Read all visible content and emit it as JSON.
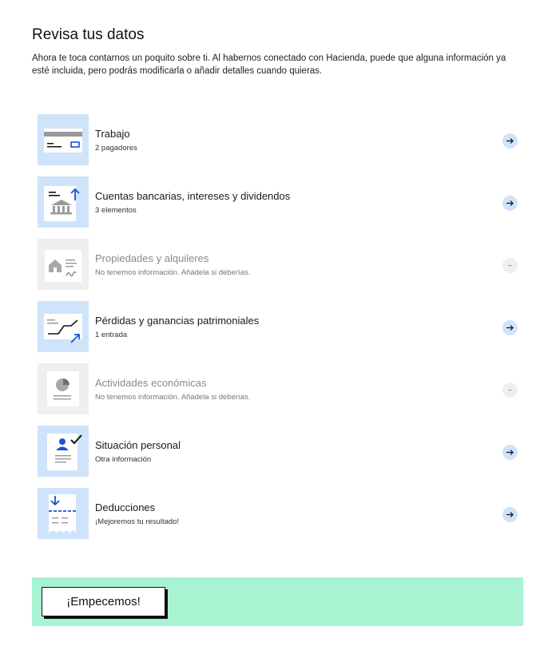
{
  "header": {
    "title": "Revisa tus datos",
    "intro": "Ahora te toca contarnos un poquito sobre ti. Al habernos conectado con Hacienda, puede que alguna información ya esté incluida, pero podrás modificarla o añadir detalles cuando quieras."
  },
  "items": [
    {
      "title": "Trabajo",
      "subtitle": "2 pagadores",
      "icon": "payslip-icon",
      "state": "active"
    },
    {
      "title": "Cuentas bancarias, intereses y dividendos",
      "subtitle": "3 elementos",
      "icon": "bank-icon",
      "state": "active"
    },
    {
      "title": "Propiedades y alquileres",
      "subtitle": "No tenemos información. Añádela si deberías.",
      "icon": "house-document-icon",
      "state": "empty"
    },
    {
      "title": "Pérdidas y ganancias patrimoniales",
      "subtitle": "1 entrada",
      "icon": "chart-trend-icon",
      "state": "active"
    },
    {
      "title": "Actividades económicas",
      "subtitle": "No tenemos información. Añádela si deberías.",
      "icon": "pie-document-icon",
      "state": "empty"
    },
    {
      "title": "Situación personal",
      "subtitle": "Otra información",
      "icon": "person-check-icon",
      "state": "active"
    },
    {
      "title": "Deducciones",
      "subtitle": "¡Mejoremos tu resultado!",
      "icon": "receipt-download-icon",
      "state": "active"
    }
  ],
  "footer": {
    "cta_label": "¡Empecemos!"
  },
  "colors": {
    "icon_bg_active": "#cfe4fb",
    "icon_bg_muted": "#efefef",
    "accent_blue": "#1f4fd0",
    "footer_bg": "#a7f3d2"
  }
}
